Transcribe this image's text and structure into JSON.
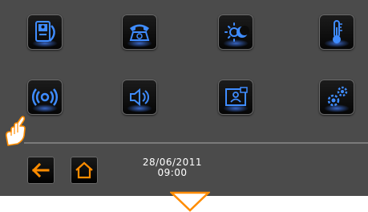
{
  "colors": {
    "panel_background": "#4b4b4b",
    "tile_icon_blue": "#3f8cff",
    "nav_icon_orange": "#ff8c00",
    "scroll_arrow_orange": "#ff8c00"
  },
  "menu": {
    "items": [
      {
        "icon": "video-entry-phone-icon"
      },
      {
        "icon": "telephone-icon"
      },
      {
        "icon": "day-night-scenario-icon"
      },
      {
        "icon": "thermometer-icon"
      },
      {
        "icon": "alarm-signal-icon"
      },
      {
        "icon": "speaker-volume-icon"
      },
      {
        "icon": "contact-card-icon"
      },
      {
        "icon": "settings-gears-icon"
      }
    ]
  },
  "footer": {
    "back_icon": "back-arrow-icon",
    "home_icon": "home-icon",
    "date": "28/06/2011",
    "time": "09:00"
  },
  "scroll_down_icon": "scroll-down-triangle-icon",
  "pointer_icon": "pointing-hand-icon"
}
